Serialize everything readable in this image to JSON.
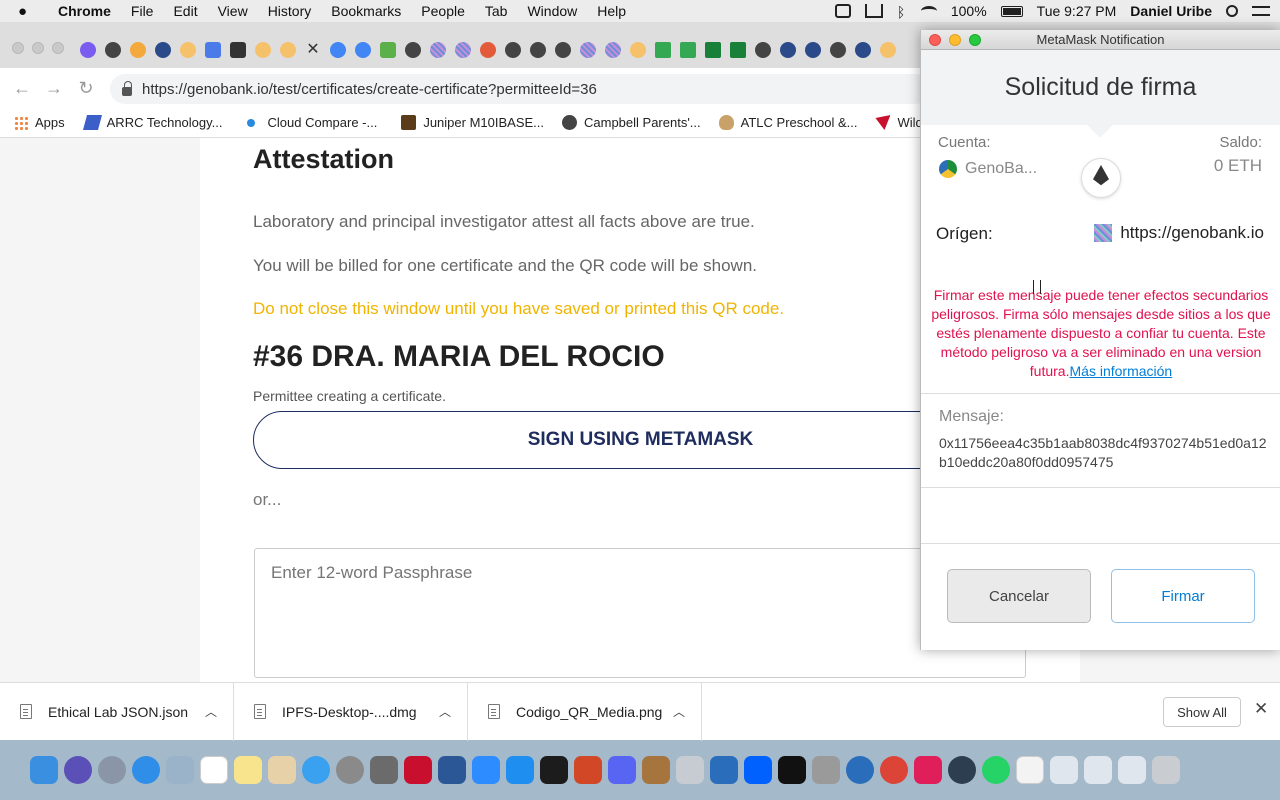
{
  "menubar": {
    "app": "Chrome",
    "items": [
      "File",
      "Edit",
      "View",
      "History",
      "Bookmarks",
      "People",
      "Tab",
      "Window",
      "Help"
    ],
    "battery": "100%",
    "clock": "Tue 9:27 PM",
    "user": "Daniel Uribe"
  },
  "browser": {
    "url": "https://genobank.io/test/certificates/create-certificate?permitteeId=36",
    "tab_close": "✕",
    "bookmarks": [
      {
        "label": "Apps",
        "icon": "apps-grid-icon"
      },
      {
        "label": "ARRC Technology...",
        "icon": "arrc-icon"
      },
      {
        "label": "Cloud Compare -...",
        "icon": "cloud-icon"
      },
      {
        "label": "Juniper M10IBASE...",
        "icon": "juniper-icon"
      },
      {
        "label": "Campbell Parents'...",
        "icon": "globe-icon"
      },
      {
        "label": "ATLC Preschool &...",
        "icon": "palette-icon"
      },
      {
        "label": "Wild Sa",
        "icon": "wild-icon"
      }
    ]
  },
  "page": {
    "heading": "Attestation",
    "attest_text": "Laboratory and principal investigator attest all facts above are true.",
    "billing_text": "You will be billed for one certificate and the QR code will be shown.",
    "warning_text": "Do not close this window until you have saved or printed this QR code.",
    "permittee_title": "#36 DRA. MARIA DEL ROCIO",
    "permittee_sub": "Permittee creating a certificate.",
    "sign_button": "SIGN USING METAMASK",
    "or_text": "or...",
    "passphrase_placeholder": "Enter 12-word Passphrase"
  },
  "downloads": {
    "items": [
      "Ethical Lab JSON.json",
      "IPFS-Desktop-....dmg",
      "Codigo_QR_Media.png"
    ],
    "show_all": "Show All"
  },
  "metamask": {
    "window_title": "MetaMask Notification",
    "header": "Solicitud de firma",
    "account_label": "Cuenta:",
    "account_name": "GenoBa...",
    "balance_label": "Saldo:",
    "balance": "0 ETH",
    "origin_label": "Orígen:",
    "origin": "https://genobank.io",
    "warning": "Firmar este mensaje puede tener efectos secundarios peligrosos. Firma sólo mensajes desde sitios a los que estés plenamente dispuesto a confiar tu cuenta. Este método peligroso va a ser eliminado en una version futura.",
    "more_info": "Más información",
    "message_label": "Mensaje:",
    "message": "0x11756eea4c35b1aab8038dc4f9370274b51ed0a12b10eddc20a80f0dd0957475",
    "cancel": "Cancelar",
    "sign": "Firmar"
  },
  "colors": {
    "warning_yellow": "#f0b400",
    "metamask_red": "#e0114f",
    "metamask_blue": "#037dd6",
    "primary_navy": "#1f2c5e"
  }
}
